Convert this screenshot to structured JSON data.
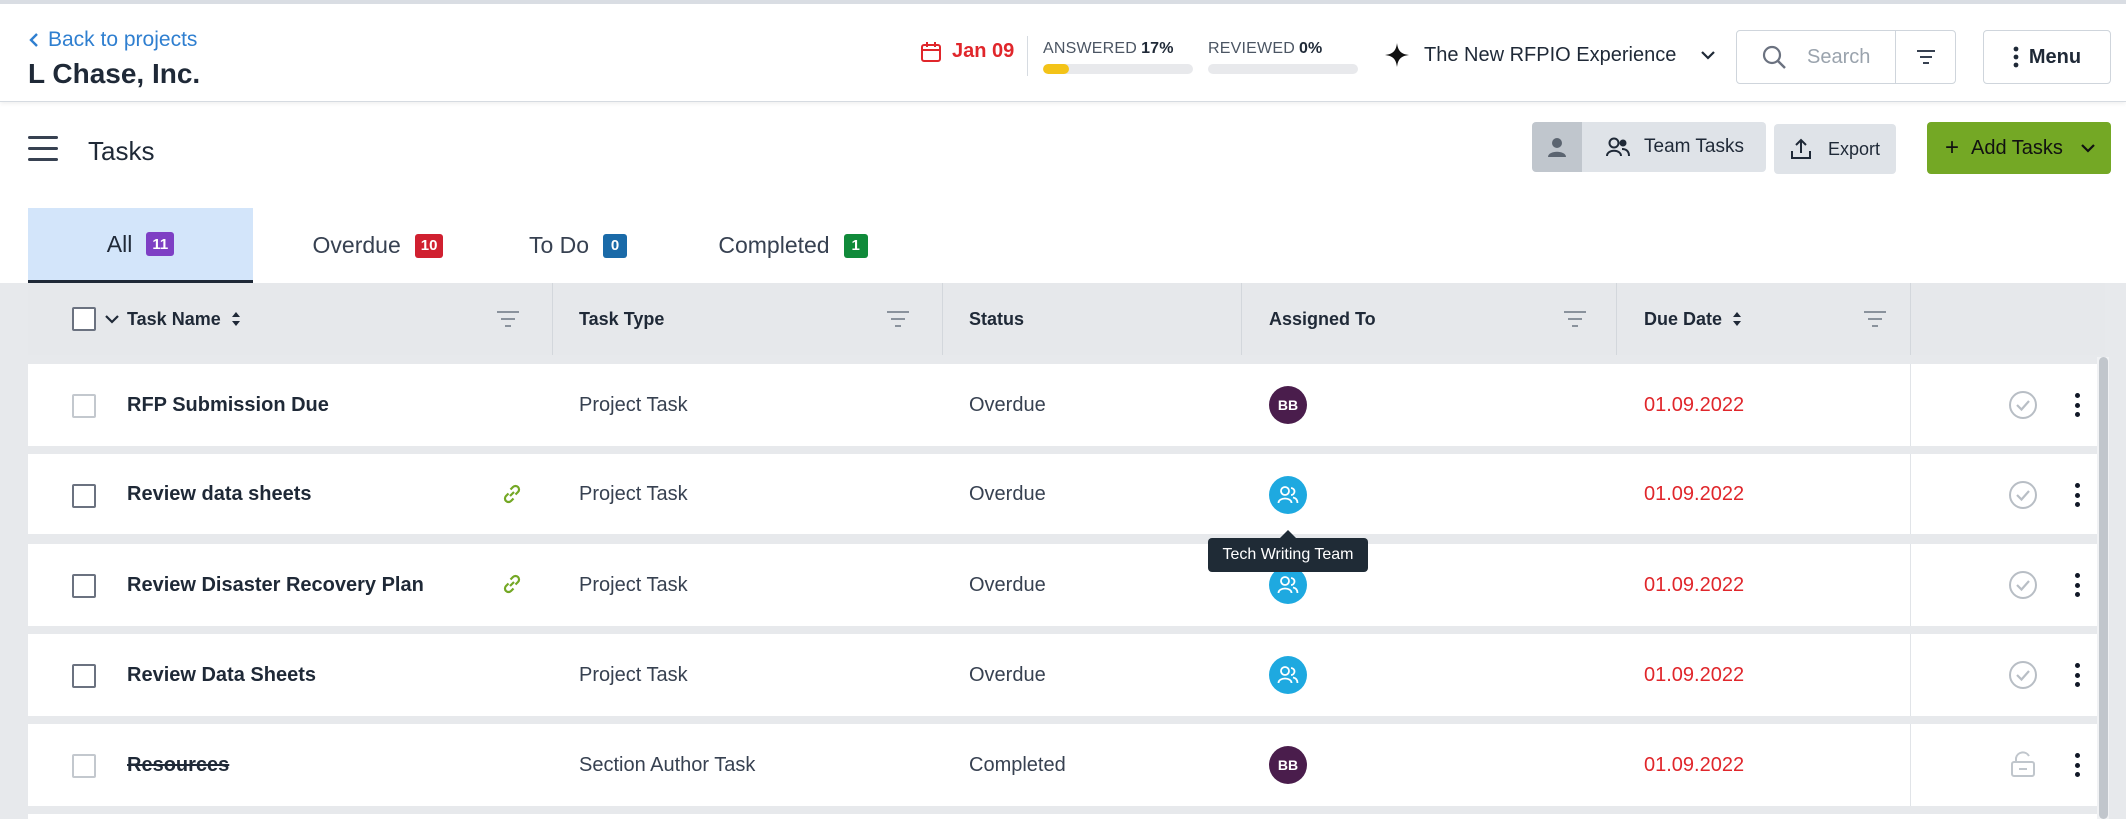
{
  "header": {
    "back_label": "Back to projects",
    "company": "L Chase, Inc.",
    "due_date": "Jan 09",
    "answered_label": "ANSWERED",
    "answered_pct": "17%",
    "answered_fraction": 0.17,
    "reviewed_label": "REVIEWED",
    "reviewed_pct": "0%",
    "reviewed_fraction": 0,
    "experience_label": "The New RFPIO Experience",
    "search_placeholder": "Search",
    "menu_label": "Menu",
    "accent_color": "#e0262b"
  },
  "toolbar": {
    "title": "Tasks",
    "team_tasks_label": "Team Tasks",
    "export_label": "Export",
    "add_tasks_label": "Add Tasks",
    "add_color": "#74a825"
  },
  "tabs": [
    {
      "label": "All",
      "count": "11",
      "color": "#7e3fc4",
      "active": true
    },
    {
      "label": "Overdue",
      "count": "10",
      "color": "#d02030"
    },
    {
      "label": "To Do",
      "count": "0",
      "color": "#1a6aa8"
    },
    {
      "label": "Completed",
      "count": "1",
      "color": "#108a3a"
    }
  ],
  "table": {
    "columns": [
      "Task Name",
      "Task Type",
      "Status",
      "Assigned To",
      "Due Date"
    ],
    "rows": [
      {
        "name": "RFP Submission Due",
        "type": "Project Task",
        "status": "Overdue",
        "assignee": "BB",
        "due": "01.09.2022"
      },
      {
        "name": "Review data sheets",
        "type": "Project Task",
        "status": "Overdue",
        "assignee": "",
        "due": "01.09.2022"
      },
      {
        "name": "Review Disaster Recovery Plan",
        "type": "Project Task",
        "status": "Overdue",
        "assignee": "",
        "due": "01.09.2022"
      },
      {
        "name": "Review Data Sheets",
        "type": "Project Task",
        "status": "Overdue",
        "assignee": "",
        "due": "01.09.2022"
      },
      {
        "name": "Resources",
        "type": "Section Author Task",
        "status": "Completed",
        "assignee": "BB",
        "due": "01.09.2022"
      }
    ]
  },
  "tooltip": "Tech Writing Team",
  "icons": [
    "chevron-left-icon",
    "calendar-icon",
    "sparkle-icon",
    "chevron-down-icon",
    "search-icon",
    "filter-icon",
    "kebab-icon",
    "hamburger-icon",
    "user-icon",
    "team-icon",
    "upload-icon",
    "plus-icon",
    "sort-icon",
    "link-icon",
    "check-circle-icon",
    "unlock-icon"
  ]
}
